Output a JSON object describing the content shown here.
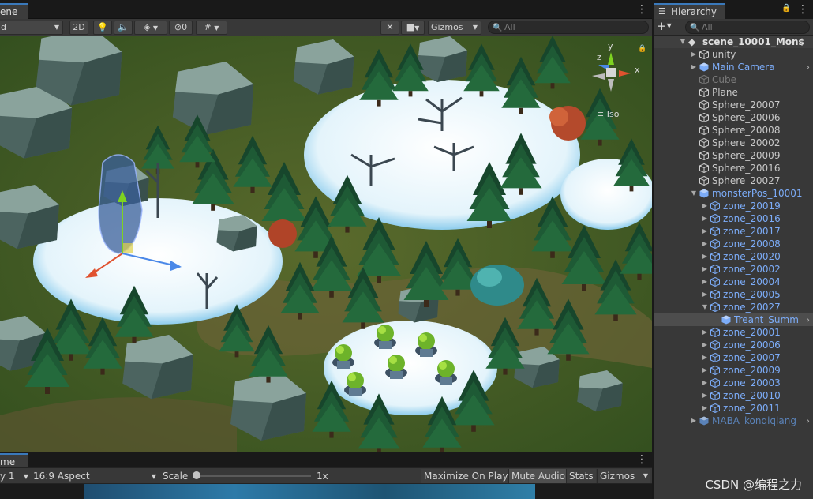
{
  "scene": {
    "tab_label": "ene",
    "shading_mode": "d",
    "toolbar": {
      "btn_2d": "2D",
      "hidden_count": "0",
      "gizmos_label": "Gizmos",
      "search_placeholder": "All"
    },
    "orientation_gizmo": {
      "y": "y",
      "x": "x",
      "z": "z",
      "projection_label": "Iso"
    }
  },
  "game": {
    "tab_label": "me",
    "display_label": "y 1",
    "aspect_label": "16:9 Aspect",
    "scale_label": "Scale",
    "scale_value": "1x",
    "scale_level": 0.0,
    "maximize_label": "Maximize On Play",
    "mute_label": "Mute Audio",
    "stats_label": "Stats",
    "gizmos_label": "Gizmos"
  },
  "hierarchy": {
    "title": "Hierarchy",
    "search_placeholder": "All",
    "add_label": "+",
    "root": "scene_10001_Mons",
    "items": [
      {
        "label": "unity",
        "color": "normal"
      },
      {
        "label": "Main Camera",
        "color": "blue"
      },
      {
        "label": "Cube",
        "color": "dim"
      },
      {
        "label": "Plane",
        "color": "normal"
      },
      {
        "label": "Sphere_20007",
        "color": "normal"
      },
      {
        "label": "Sphere_20006",
        "color": "normal"
      },
      {
        "label": "Sphere_20008",
        "color": "normal"
      },
      {
        "label": "Sphere_20002",
        "color": "normal"
      },
      {
        "label": "Sphere_20009",
        "color": "normal"
      },
      {
        "label": "Sphere_20016",
        "color": "normal"
      },
      {
        "label": "Sphere_20027",
        "color": "normal"
      },
      {
        "label": "monsterPos_10001",
        "color": "blue"
      },
      {
        "label": "zone_20019",
        "color": "blue"
      },
      {
        "label": "zone_20016",
        "color": "blue"
      },
      {
        "label": "zone_20017",
        "color": "blue"
      },
      {
        "label": "zone_20008",
        "color": "blue"
      },
      {
        "label": "zone_20020",
        "color": "blue"
      },
      {
        "label": "zone_20002",
        "color": "blue"
      },
      {
        "label": "zone_20004",
        "color": "blue"
      },
      {
        "label": "zone_20005",
        "color": "blue"
      },
      {
        "label": "zone_20027",
        "color": "blue"
      },
      {
        "label": "Treant_Summ",
        "color": "blue"
      },
      {
        "label": "zone_20001",
        "color": "blue"
      },
      {
        "label": "zone_20006",
        "color": "blue"
      },
      {
        "label": "zone_20007",
        "color": "blue"
      },
      {
        "label": "zone_20009",
        "color": "blue"
      },
      {
        "label": "zone_20003",
        "color": "blue"
      },
      {
        "label": "zone_20010",
        "color": "blue"
      },
      {
        "label": "zone_20011",
        "color": "blue"
      },
      {
        "label": "MABA_konqiqiang",
        "color": "dimblue"
      }
    ]
  },
  "watermark": "CSDN @编程之力"
}
